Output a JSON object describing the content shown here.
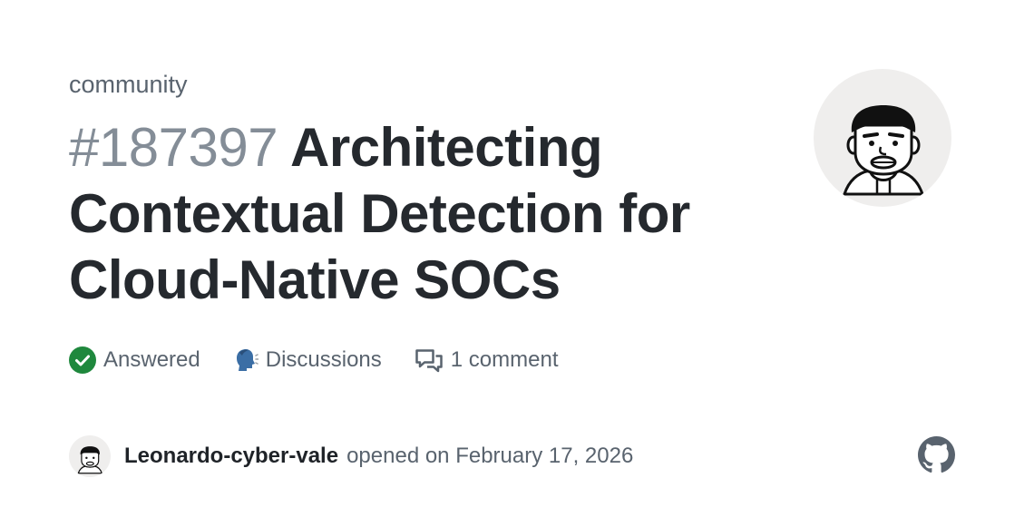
{
  "card": {
    "repo": "community",
    "issue_number": "#187397",
    "title": "Architecting Contextual Detection for Cloud-Native SOCs"
  },
  "meta": {
    "status_icon": "check-circle-icon",
    "status_color": "#1f883d",
    "status_label": "Answered",
    "category_icon": "speaking-head-emoji",
    "category_label": "Discussions",
    "comments_icon": "comment-discussion-icon",
    "comments_label": "1 comment"
  },
  "footer": {
    "author": "Leonardo-cyber-vale",
    "opened_text": "opened on February 17, 2026"
  },
  "brand": {
    "logo": "github-mark-icon",
    "logo_color": "#59636e"
  }
}
